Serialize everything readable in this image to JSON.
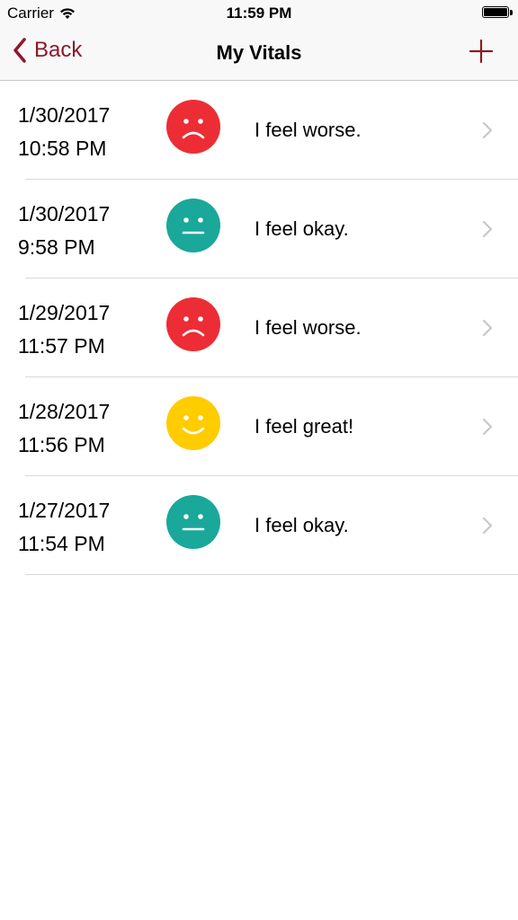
{
  "status_bar": {
    "carrier": "Carrier",
    "time": "11:59 PM"
  },
  "nav": {
    "back_label": "Back",
    "title": "My Vitals",
    "accent_color": "#8b1a2b"
  },
  "colors": {
    "worse": "#ec2d35",
    "okay": "#19a89a",
    "great": "#ffcc00"
  },
  "entries": [
    {
      "date": "1/30/2017",
      "time": "10:58 PM",
      "mood": "worse",
      "text": "I feel worse."
    },
    {
      "date": "1/30/2017",
      "time": "9:58 PM",
      "mood": "okay",
      "text": "I feel okay."
    },
    {
      "date": "1/29/2017",
      "time": "11:57 PM",
      "mood": "worse",
      "text": "I feel worse."
    },
    {
      "date": "1/28/2017",
      "time": "11:56 PM",
      "mood": "great",
      "text": "I feel great!"
    },
    {
      "date": "1/27/2017",
      "time": "11:54 PM",
      "mood": "okay",
      "text": "I feel okay."
    }
  ]
}
